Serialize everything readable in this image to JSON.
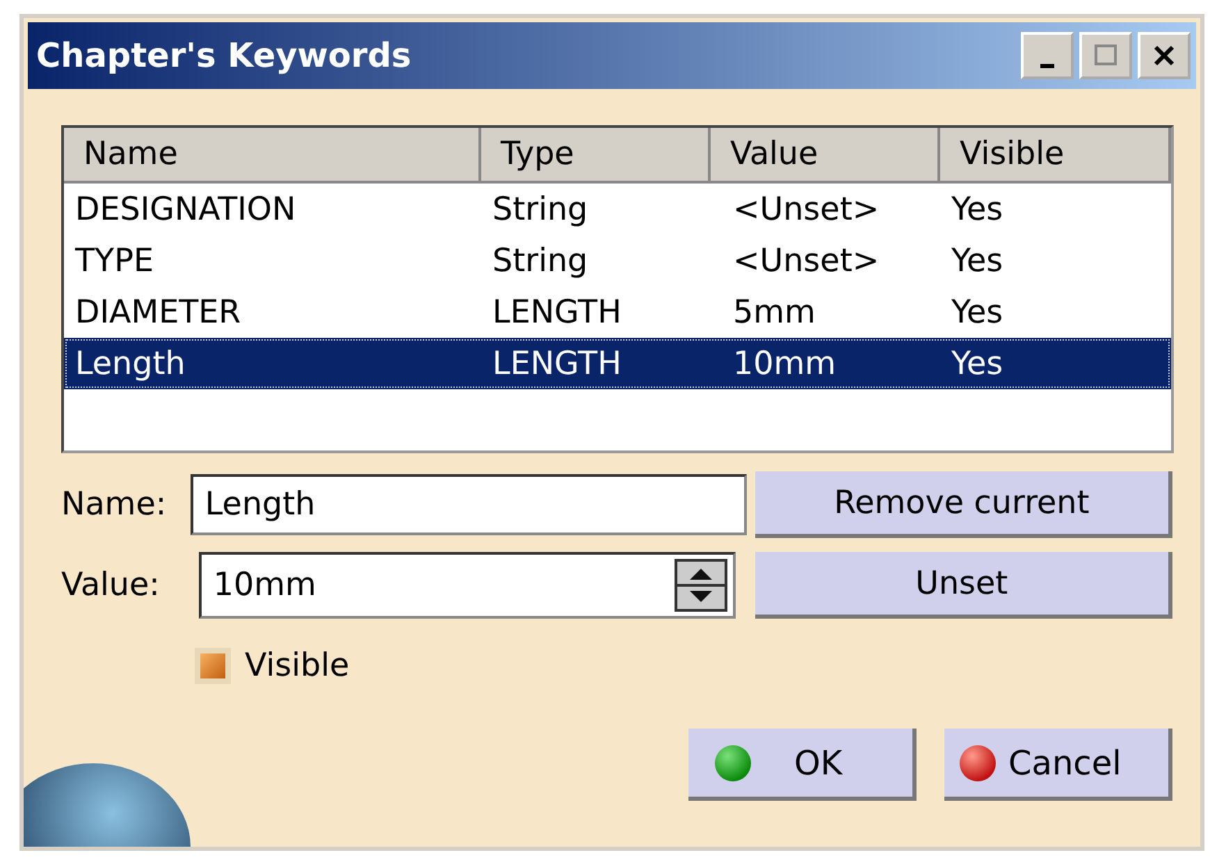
{
  "window": {
    "title": "Chapter's Keywords"
  },
  "table": {
    "columns": [
      "Name",
      "Type",
      "Value",
      "Visible"
    ],
    "rows": [
      {
        "cells": [
          "DESIGNATION",
          "String",
          "<Unset>",
          "Yes"
        ],
        "selected": false
      },
      {
        "cells": [
          "TYPE",
          "String",
          "<Unset>",
          "Yes"
        ],
        "selected": false
      },
      {
        "cells": [
          "DIAMETER",
          "LENGTH",
          "5mm",
          "Yes"
        ],
        "selected": false
      },
      {
        "cells": [
          "Length",
          "LENGTH",
          "10mm",
          "Yes"
        ],
        "selected": true
      }
    ]
  },
  "name_field": {
    "label": "Name:",
    "value": "Length"
  },
  "value_field": {
    "label": "Value:",
    "value": "10mm"
  },
  "remove_button": "Remove current",
  "unset_button": "Unset",
  "visible_checkbox": {
    "label": "Visible",
    "checked": true
  },
  "buttons": [
    {
      "kind": "ok",
      "label": "OK"
    },
    {
      "kind": "cancel",
      "label": "Cancel"
    }
  ]
}
